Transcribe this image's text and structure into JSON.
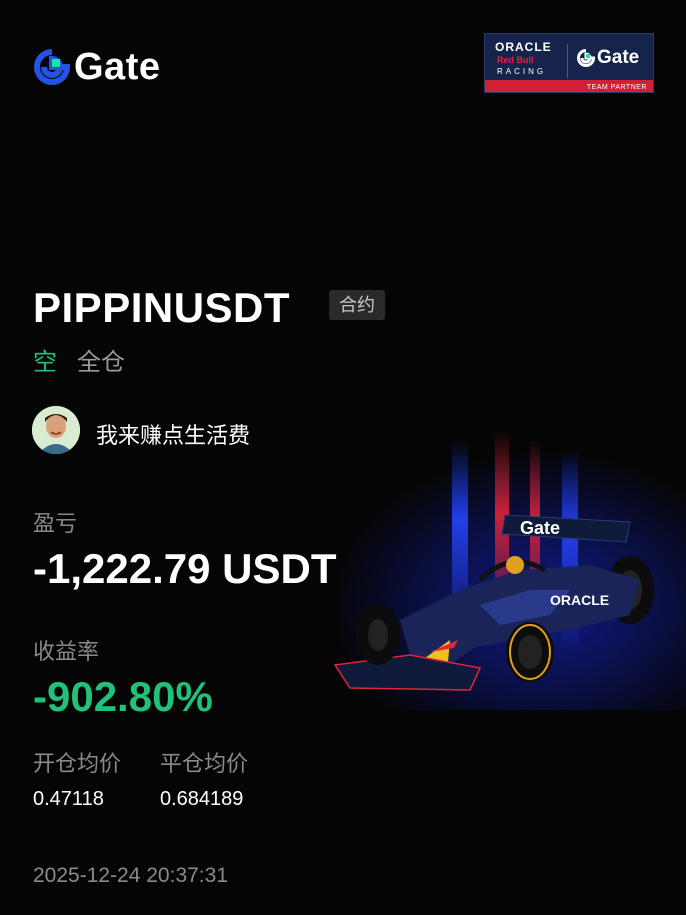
{
  "brand": {
    "name": "Gate",
    "mark_icon": "gate-logo-icon"
  },
  "partner": {
    "oracle": "ORACLE",
    "redbull": "Red Bull",
    "racing": "RACING",
    "gate": "Gate",
    "strip": "TEAM PARTNER"
  },
  "position": {
    "symbol": "PIPPINUSDT",
    "contract_tag": "合约",
    "side": "空",
    "margin_mode": "全仓"
  },
  "user": {
    "name": "我来赚点生活费",
    "avatar_icon": "user-avatar-icon"
  },
  "stats": {
    "pnl_label": "盈亏",
    "pnl_value": "-1,222.79 USDT",
    "roi_label": "收益率",
    "roi_value": "-902.80%",
    "entry_label": "开仓均价",
    "exit_label": "平仓均价",
    "entry_value": "0.47118",
    "exit_value": "0.684189",
    "timestamp": "2025-12-24 20:37:31"
  },
  "colors": {
    "background": "#050505",
    "profit_green": "#21c17a",
    "muted": "#8a8a8a",
    "brand_blue": "#2354e6",
    "brand_green": "#17e6a1",
    "redbull_navy": "#16234a",
    "redbull_red": "#d11f35"
  },
  "artwork": {
    "car_icon": "f1-car-icon",
    "car_wing_text": "Gate",
    "car_sidepod_text": "ORACLE"
  }
}
